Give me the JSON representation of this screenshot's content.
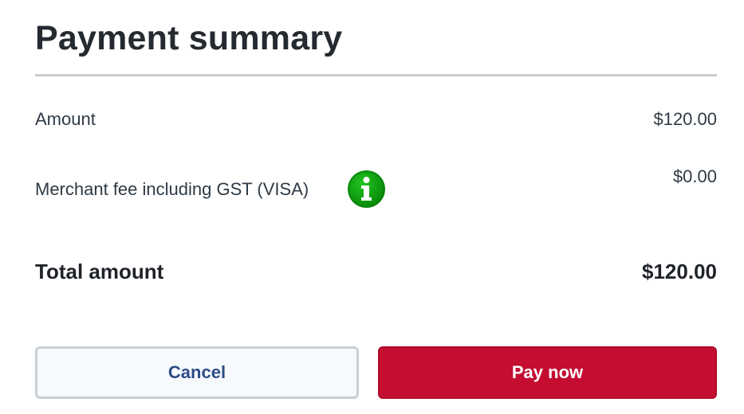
{
  "header": {
    "title": "Payment summary"
  },
  "summary": {
    "amount": {
      "label": "Amount",
      "value": "$120.00"
    },
    "merchant_fee": {
      "label": "Merchant fee including GST (VISA)",
      "value": "$0.00",
      "icon": "info-icon",
      "icon_color": "#0b9a0b"
    },
    "total": {
      "label": "Total amount",
      "value": "$120.00"
    }
  },
  "actions": {
    "cancel_label": "Cancel",
    "pay_label": "Pay now",
    "pay_color": "#c40d31",
    "cancel_text_color": "#2e4b86"
  }
}
